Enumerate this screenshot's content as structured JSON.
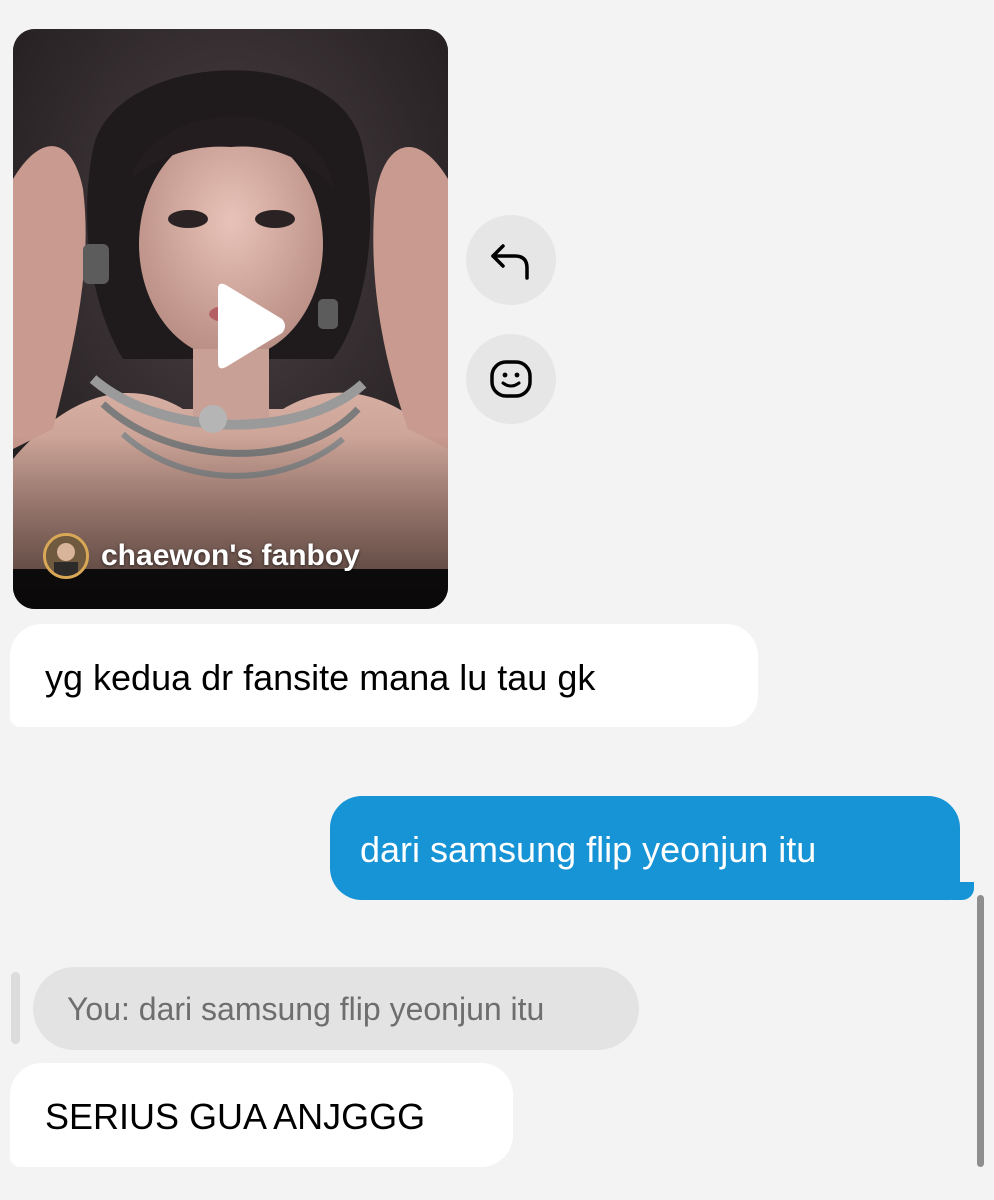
{
  "shared_post": {
    "author": "chaewon's fanboy",
    "play_icon": "play-icon"
  },
  "actions": {
    "reply_icon": "reply-arrow-icon",
    "react_icon": "smiley-react-icon"
  },
  "messages": [
    {
      "direction": "incoming",
      "text": "yg kedua dr fansite mana lu tau gk"
    },
    {
      "direction": "outgoing",
      "text": "dari samsung flip yeonjun itu"
    },
    {
      "direction": "incoming",
      "reply_preview": "You: dari samsung flip yeonjun itu",
      "text": "SERIUS GUA ANJGGG"
    }
  ],
  "colors": {
    "outgoing_bubble": "#1694d6",
    "incoming_bubble": "#ffffff",
    "background": "#f3f3f3"
  }
}
